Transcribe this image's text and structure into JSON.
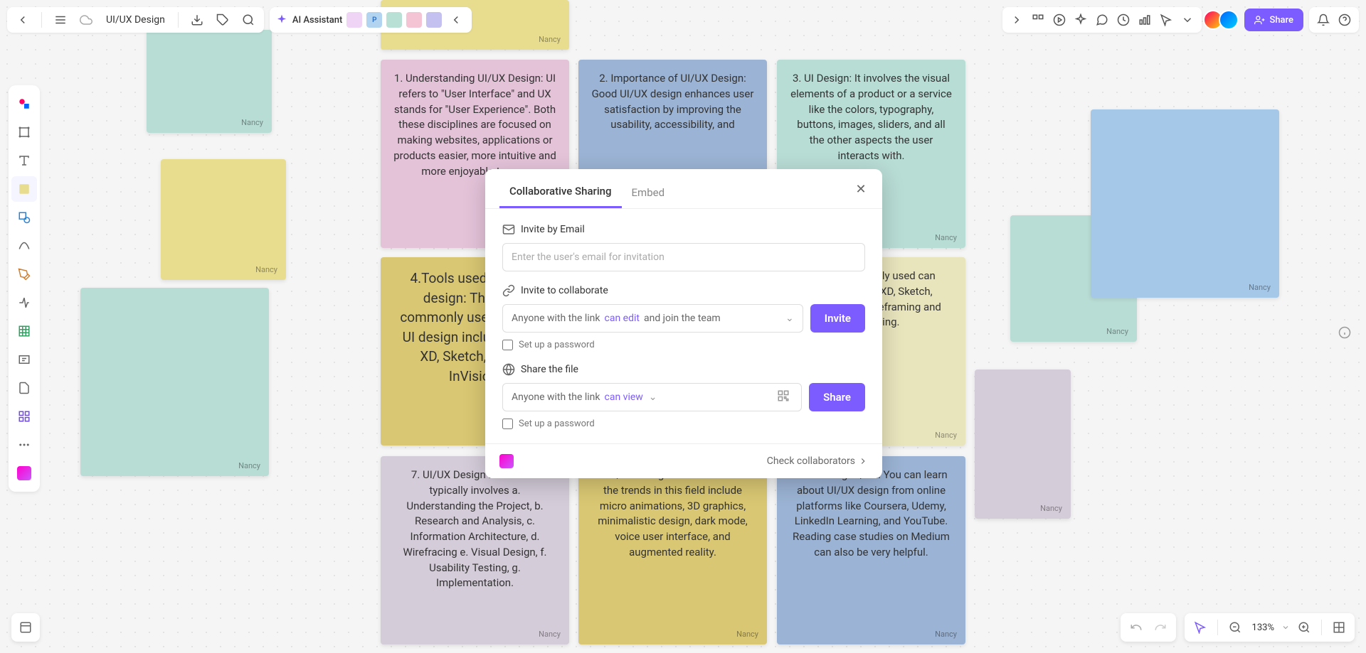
{
  "doc_title": "UI/UX Design",
  "ai_label": "AI Assistant",
  "share_btn": "Share",
  "zoom": "133%",
  "notes": {
    "author": "Nancy",
    "n1": "1. Understanding UI/UX Design: UI refers to \"User Interface\" and UX stands for \"User Experience\". Both these disciplines are focused on making websites, applications or products easier, more intuitive and more enjoyable to use.",
    "n2": "2. Importance of UI/UX Design: Good UI/UX design enhances user satisfaction by improving the usability, accessibility, and",
    "n3": "3. UI Design: It involves the visual elements of a product or a service like the colors, typography, buttons, images, sliders, and all the other aspects the user interacts with.",
    "n4": "4.Tools used in UI/UX design: The most commonly used tools for UI design include Adobe XD, Sketch, Figma, InVision.",
    "n5_partial": "UX Design: It only used can include Adobe XD, Sketch, Balsamiq for wireframing and prototyping.",
    "n7": "7. UI/UX Design Process: It typically involves a. Understanding the Project, b. Research and Analysis, c. Information Architecture, d. Wirefracing e. Visual Design, f. Usability Testing, g. Implementation.",
    "n8": "8. UI/UX Design Trends: Some of the trends in this field include micro animations, 3D graphics, minimalistic design, dark mode, voice user interface, and augmented reality.",
    "n9": "9. Learning UI/UX: You can learn about UI/UX design from online platforms like Coursera, Udemy, LinkedIn Learning, and YouTube. Reading case studies on Medium can also be very helpful."
  },
  "modal": {
    "tab1": "Collaborative Sharing",
    "tab2": "Embed",
    "invite_email": "Invite by Email",
    "email_placeholder": "Enter the user's email for invitation",
    "invite_collab": "Invite to collaborate",
    "anyone_link": "Anyone with the link",
    "can_edit": "can edit",
    "can_view": "can view",
    "join_team": "and join the team",
    "invite_btn": "Invite",
    "setup_pwd": "Set up a password",
    "share_file": "Share the file",
    "share_btn": "Share",
    "check_collab": "Check collaborators"
  }
}
